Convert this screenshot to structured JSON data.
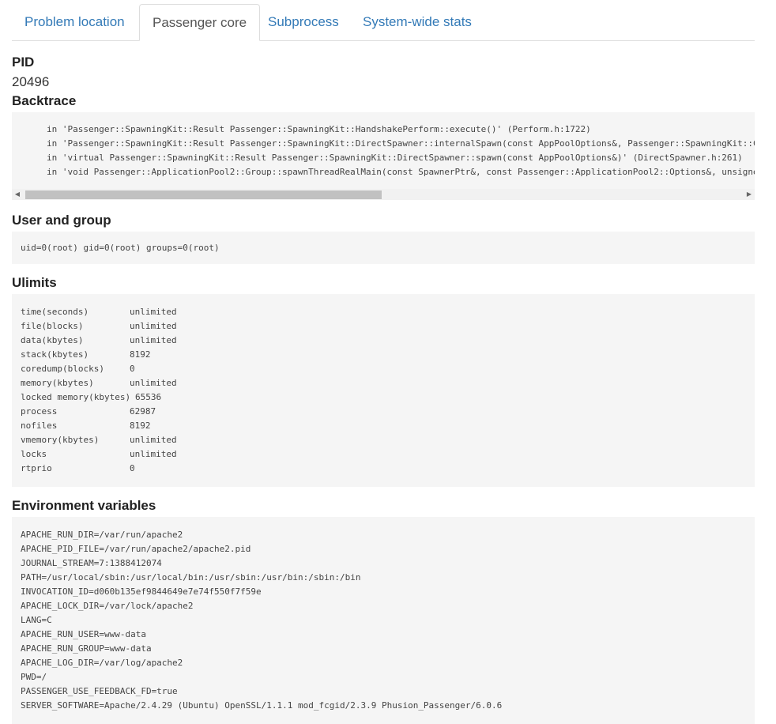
{
  "tabs": [
    {
      "label": "Problem location"
    },
    {
      "label": "Passenger core"
    },
    {
      "label": "Subprocess"
    },
    {
      "label": "System-wide stats"
    }
  ],
  "pid": {
    "heading": "PID",
    "value": "20496"
  },
  "backtrace": {
    "heading": "Backtrace",
    "lines": [
      "in 'Passenger::SpawningKit::Result Passenger::SpawningKit::HandshakePerform::execute()' (Perform.h:1722)",
      "in 'Passenger::SpawningKit::Result Passenger::SpawningKit::DirectSpawner::internalSpawn(const AppPoolOptions&, Passenger::SpawningKit::C",
      "in 'virtual Passenger::SpawningKit::Result Passenger::SpawningKit::DirectSpawner::spawn(const AppPoolOptions&)' (DirectSpawner.h:261)",
      "in 'void Passenger::ApplicationPool2::Group::spawnThreadRealMain(const SpawnerPtr&, const Passenger::ApplicationPool2::Options&, unsigne"
    ],
    "scroll_left": "◀",
    "scroll_right": "▶"
  },
  "user_group": {
    "heading": "User and group",
    "value": "uid=0(root) gid=0(root) groups=0(root)"
  },
  "ulimits": {
    "heading": "Ulimits",
    "rows": [
      {
        "key": "time(seconds)",
        "value": "unlimited"
      },
      {
        "key": "file(blocks)",
        "value": "unlimited"
      },
      {
        "key": "data(kbytes)",
        "value": "unlimited"
      },
      {
        "key": "stack(kbytes)",
        "value": "8192"
      },
      {
        "key": "coredump(blocks)",
        "value": "0"
      },
      {
        "key": "memory(kbytes)",
        "value": "unlimited"
      },
      {
        "key": "locked memory(kbytes)",
        "value": "65536"
      },
      {
        "key": "process",
        "value": "62987"
      },
      {
        "key": "nofiles",
        "value": "8192"
      },
      {
        "key": "vmemory(kbytes)",
        "value": "unlimited"
      },
      {
        "key": "locks",
        "value": "unlimited"
      },
      {
        "key": "rtprio",
        "value": "0"
      }
    ]
  },
  "env": {
    "heading": "Environment variables",
    "lines": [
      "APACHE_RUN_DIR=/var/run/apache2",
      "APACHE_PID_FILE=/var/run/apache2/apache2.pid",
      "JOURNAL_STREAM=7:1388412074",
      "PATH=/usr/local/sbin:/usr/local/bin:/usr/sbin:/usr/bin:/sbin:/bin",
      "INVOCATION_ID=d060b135ef9844649e7e74f550f7f59e",
      "APACHE_LOCK_DIR=/var/lock/apache2",
      "LANG=C",
      "APACHE_RUN_USER=www-data",
      "APACHE_RUN_GROUP=www-data",
      "APACHE_LOG_DIR=/var/log/apache2",
      "PWD=/",
      "PASSENGER_USE_FEEDBACK_FD=true",
      "SERVER_SOFTWARE=Apache/2.4.29 (Ubuntu) OpenSSL/1.1.1 mod_fcgid/2.3.9 Phusion_Passenger/6.0.6"
    ]
  }
}
